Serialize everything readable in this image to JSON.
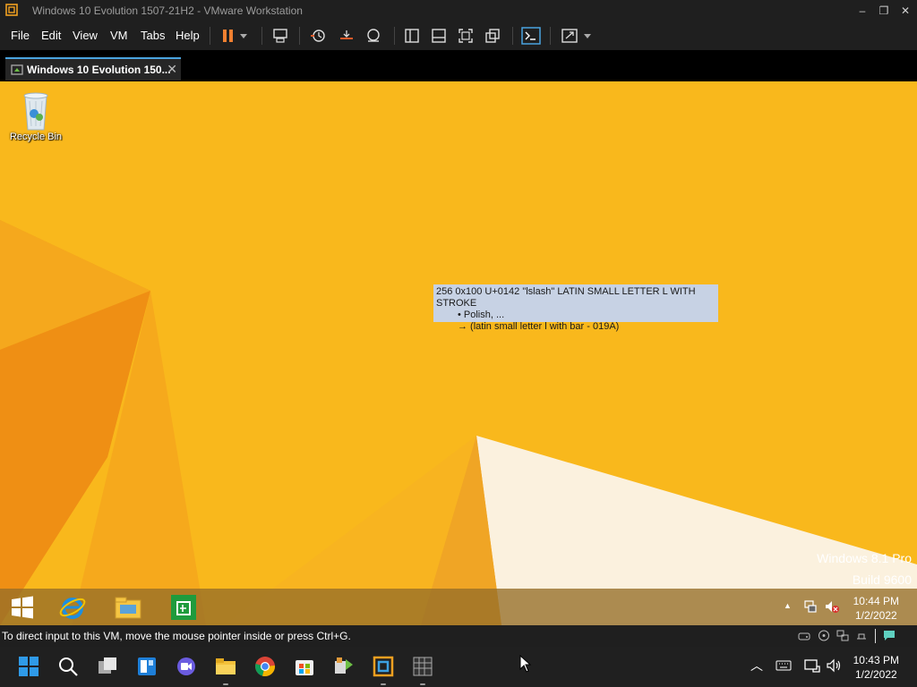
{
  "window": {
    "title": "Windows 10 Evolution 1507-21H2 - VMware Workstation",
    "minimize_glyph": "–",
    "maximize_glyph": "❐",
    "close_glyph": "✕"
  },
  "menu": {
    "file": "File",
    "edit": "Edit",
    "view": "View",
    "vm": "VM",
    "tabs": "Tabs",
    "help": "Help"
  },
  "toolbar_icons": [
    "pause-icon",
    "dropdown-arrow-icon",
    "send-ctrl-alt-del-icon",
    "snapshot-icon",
    "revert-snapshot-icon",
    "snapshot-manager-icon",
    "library-icon",
    "thumbnail-bar-icon",
    "full-screen-icon",
    "unity-icon",
    "console-view-icon",
    "stretch-guest-icon",
    "dropdown-arrow-icon"
  ],
  "tab": {
    "label": "Windows 10 Evolution 150...",
    "close_glyph": "✕"
  },
  "guest": {
    "recycle_bin_label": "Recycle Bin",
    "tooltip": {
      "line1": "256 0x100 U+0142 \"lslash\" LATIN SMALL LETTER L WITH STROKE",
      "line2": "• Polish, ...",
      "line3": "→ (latin small letter l with bar - 019A)"
    },
    "watermark_line1": "Windows 8.1 Pro",
    "watermark_line2": "Build 9600",
    "taskbar": {
      "tray_up_glyph": "▲",
      "clock_time": "10:44 PM",
      "clock_date": "1/2/2022"
    }
  },
  "statusbar": {
    "message": "To direct input to this VM, move the mouse pointer inside or press Ctrl+G."
  },
  "host_taskbar": {
    "tray_up_glyph": "︿",
    "clock_time": "10:43 PM",
    "clock_date": "1/2/2022"
  },
  "colors": {
    "wallpaper": "#f9b81c",
    "chrome_dark": "#1f1f1f",
    "accent": "#4aa3df",
    "pause_orange": "#f08030"
  }
}
